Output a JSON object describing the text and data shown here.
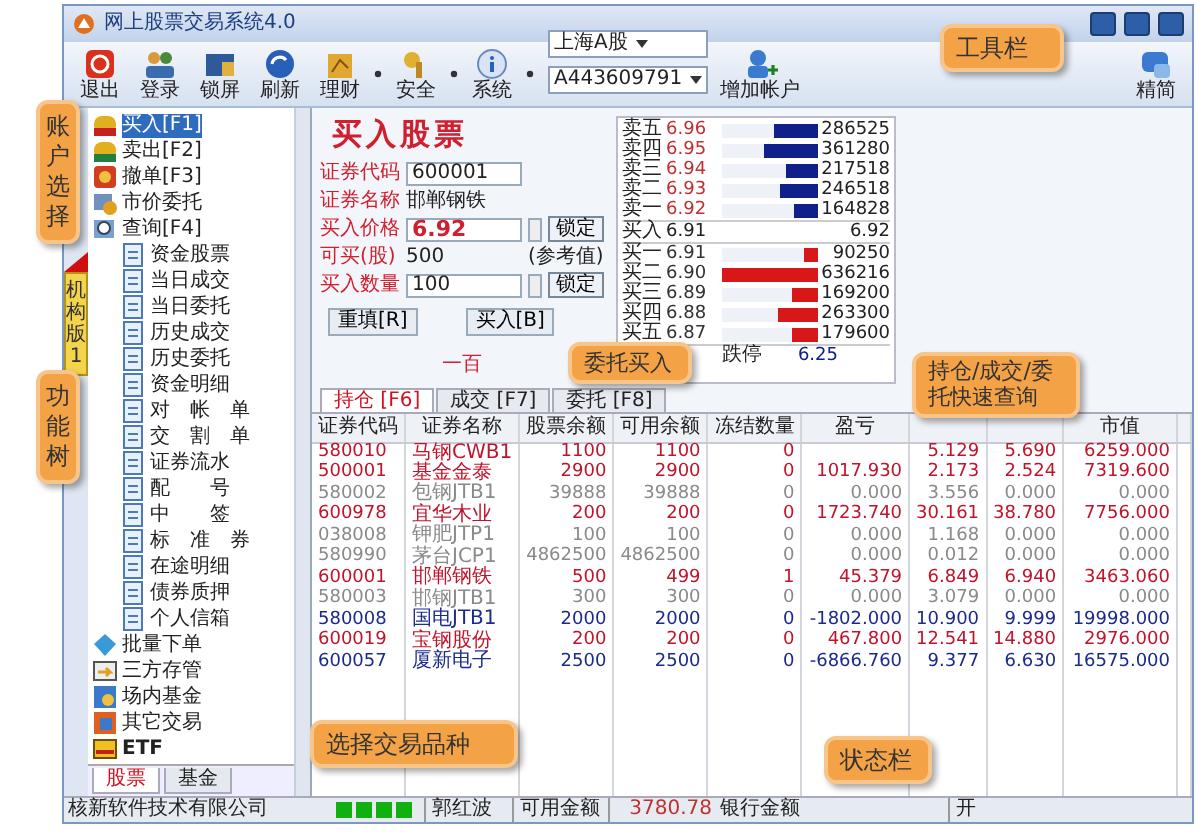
{
  "window": {
    "title": "网上股票交易系统4.0"
  },
  "toolbar": [
    {
      "label": "退出",
      "kind": "exit",
      "menu": false
    },
    {
      "label": "登录",
      "kind": "login",
      "menu": false
    },
    {
      "label": "锁屏",
      "kind": "lock",
      "menu": false
    },
    {
      "label": "刷新",
      "kind": "refresh",
      "menu": false
    },
    {
      "label": "理财",
      "kind": "finance",
      "menu": true
    },
    {
      "label": "安全",
      "kind": "security",
      "menu": true
    },
    {
      "label": "系统",
      "kind": "info",
      "menu": true
    }
  ],
  "market_select": {
    "value": "上海A股"
  },
  "account_select": {
    "value": "A443609791"
  },
  "add_account": {
    "label": "增加帐户"
  },
  "compact": {
    "label": "精简"
  },
  "side_tabs": [
    {
      "label": "机构版1",
      "selected": true
    }
  ],
  "tree": [
    {
      "label": "买入[F1]",
      "kind": "buy",
      "selected": true
    },
    {
      "label": "卖出[F2]",
      "kind": "sell",
      "selected": false
    },
    {
      "label": "撤单[F3]",
      "kind": "cancel",
      "selected": false
    },
    {
      "label": "市价委托",
      "kind": "market",
      "selected": false
    },
    {
      "label": "查询[F4]",
      "kind": "query",
      "selected": false,
      "children": [
        {
          "label": "资金股票",
          "kind": "doc",
          "selected": false
        },
        {
          "label": "当日成交",
          "kind": "doc",
          "selected": false
        },
        {
          "label": "当日委托",
          "kind": "doc",
          "selected": false
        },
        {
          "label": "历史成交",
          "kind": "doc",
          "selected": false
        },
        {
          "label": "历史委托",
          "kind": "doc",
          "selected": false
        },
        {
          "label": "资金明细",
          "kind": "doc",
          "selected": false
        },
        {
          "label": "对　帐　单",
          "kind": "doc",
          "selected": false
        },
        {
          "label": "交　割　单",
          "kind": "doc",
          "selected": false
        },
        {
          "label": "证券流水",
          "kind": "doc",
          "selected": false
        },
        {
          "label": "配　　号",
          "kind": "doc",
          "selected": false
        },
        {
          "label": "中　　签",
          "kind": "doc",
          "selected": false
        },
        {
          "label": "标　准　券",
          "kind": "doc",
          "selected": false
        },
        {
          "label": "在途明细",
          "kind": "doc",
          "selected": false
        },
        {
          "label": "债券质押",
          "kind": "doc",
          "selected": false
        },
        {
          "label": "个人信箱",
          "kind": "doc",
          "selected": false
        }
      ]
    },
    {
      "label": "批量下单",
      "kind": "batch",
      "selected": false
    },
    {
      "label": "三方存管",
      "kind": "bank",
      "selected": false
    },
    {
      "label": "场内基金",
      "kind": "fund",
      "selected": false
    },
    {
      "label": "其它交易",
      "kind": "other",
      "selected": false
    },
    {
      "label": "ETF",
      "kind": "etf",
      "selected": false
    }
  ],
  "product_tabs": [
    {
      "label": "股票",
      "selected": true
    },
    {
      "label": "基金",
      "selected": false
    }
  ],
  "buy_form": {
    "title": "买入股票",
    "code": {
      "label": "证券代码",
      "value": "600001"
    },
    "name": {
      "label": "证券名称",
      "value": "邯郸钢铁"
    },
    "price": {
      "label": "买入价格",
      "value": "6.92",
      "lock": "锁定"
    },
    "available": {
      "label": "可买(股)",
      "value": "500",
      "note": "(参考值)"
    },
    "quantity": {
      "label": "买入数量",
      "value": "100",
      "lock": "锁定"
    },
    "buttons": [
      "重填[R]",
      "买入[B]"
    ],
    "amount_words": "一百"
  },
  "order_book": {
    "asks": [
      {
        "label": "卖五",
        "price": "6.96",
        "volume": "286525",
        "level": 0.45
      },
      {
        "label": "卖四",
        "price": "6.95",
        "volume": "361280",
        "level": 0.57
      },
      {
        "label": "卖三",
        "price": "6.94",
        "volume": "217518",
        "level": 0.34
      },
      {
        "label": "卖二",
        "price": "6.93",
        "volume": "246518",
        "level": 0.39
      },
      {
        "label": "卖一",
        "price": "6.92",
        "volume": "164828",
        "level": 0.26
      }
    ],
    "last": {
      "label": "买入",
      "price": "6.91",
      "value": "6.92"
    },
    "bids": [
      {
        "label": "买一",
        "price": "6.91",
        "volume": "90250",
        "level": 0.14
      },
      {
        "label": "买二",
        "price": "6.90",
        "volume": "636216",
        "level": 1
      },
      {
        "label": "买三",
        "price": "6.89",
        "volume": "169200",
        "level": 0.27
      },
      {
        "label": "买四",
        "price": "6.88",
        "volume": "263300",
        "level": 0.41
      },
      {
        "label": "买五",
        "price": "6.87",
        "volume": "179600",
        "level": 0.28
      }
    ],
    "limit": {
      "label": "跌停",
      "price": "6.25"
    }
  },
  "tabs": [
    {
      "label": "持仓 [F6]",
      "selected": true
    },
    {
      "label": "成交 [F7]",
      "selected": false
    },
    {
      "label": "委托 [F8]",
      "selected": false
    }
  ],
  "table": {
    "columns": [
      "证券代码",
      "证券名称",
      "股票余额",
      "可用余额",
      "冻结数量",
      "盈亏",
      null,
      null,
      "市值"
    ],
    "rows": [
      {
        "color": "#c0142c",
        "cells": [
          "580010",
          "马钢CWB1",
          "1100",
          "1100",
          "0",
          null,
          "5.129",
          "5.690",
          "6259.000"
        ]
      },
      {
        "color": "#c0142c",
        "cells": [
          "500001",
          "基金金泰",
          "2900",
          "2900",
          "0",
          "1017.930",
          "2.173",
          "2.524",
          "7319.600"
        ]
      },
      {
        "color": "#8a8a8a",
        "cells": [
          "580002",
          "包钢JTB1",
          "39888",
          "39888",
          "0",
          "0.000",
          "3.556",
          "0.000",
          "0.000"
        ]
      },
      {
        "color": "#c0142c",
        "cells": [
          "600978",
          "宜华木业",
          "200",
          "200",
          "0",
          "1723.740",
          "30.161",
          "38.780",
          "7756.000"
        ]
      },
      {
        "color": "#8a8a8a",
        "cells": [
          "038008",
          "钾肥JTP1",
          "100",
          "100",
          "0",
          "0.000",
          "1.168",
          "0.000",
          "0.000"
        ]
      },
      {
        "color": "#8a8a8a",
        "cells": [
          "580990",
          "茅台JCP1",
          "4862500",
          "4862500",
          "0",
          "0.000",
          "0.012",
          "0.000",
          "0.000"
        ]
      },
      {
        "color": "#c0142c",
        "cells": [
          "600001",
          "邯郸钢铁",
          "500",
          "499",
          "1",
          "45.379",
          "6.849",
          "6.940",
          "3463.060"
        ]
      },
      {
        "color": "#8a8a8a",
        "cells": [
          "580003",
          "邯钢JTB1",
          "300",
          "300",
          "0",
          "0.000",
          "3.079",
          "0.000",
          "0.000"
        ]
      },
      {
        "color": "#1c2a8c",
        "cells": [
          "580008",
          "国电JTB1",
          "2000",
          "2000",
          "0",
          "-1802.000",
          "10.900",
          "9.999",
          "19998.000"
        ]
      },
      {
        "color": "#c0142c",
        "cells": [
          "600019",
          "宝钢股份",
          "200",
          "200",
          "0",
          "467.800",
          "12.541",
          "14.880",
          "2976.000"
        ]
      },
      {
        "color": "#1c2a8c",
        "cells": [
          "600057",
          "厦新电子",
          "2500",
          "2500",
          "0",
          "-6866.760",
          "9.377",
          "6.630",
          "16575.000"
        ]
      }
    ]
  },
  "status_bar": {
    "company": "核新软件技术有限公司",
    "user": "郭红波",
    "available_label": "可用金额",
    "available_value": "3780.78",
    "bank_label": "银行金额",
    "state": "开"
  },
  "callouts": [
    {
      "text": "账户选择",
      "kind": "vertical"
    },
    {
      "text": "功能树",
      "kind": "vertical"
    },
    {
      "text": "工具栏",
      "kind": "box"
    },
    {
      "text": "委托买入",
      "kind": "box"
    },
    {
      "text": "持仓/成交/委托快速查询",
      "kind": "box"
    },
    {
      "text": "选择交易品种",
      "kind": "box"
    },
    {
      "text": "状态栏",
      "kind": "box"
    }
  ]
}
